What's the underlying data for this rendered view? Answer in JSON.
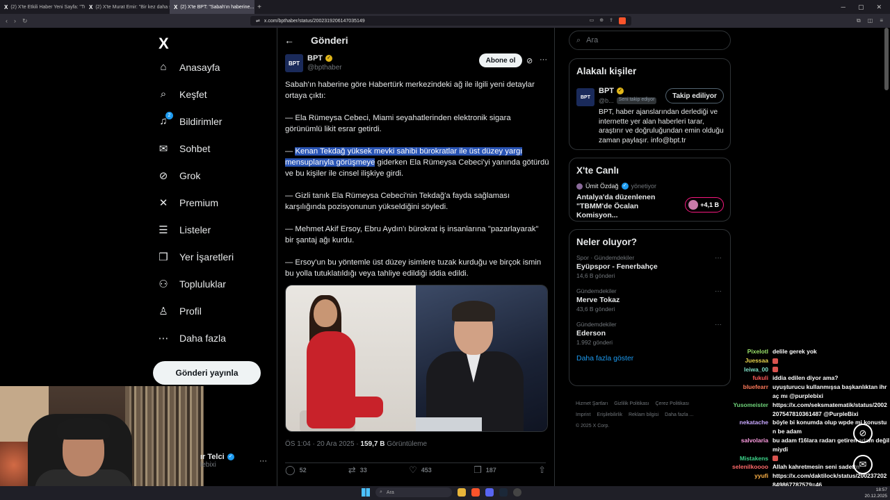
{
  "browser": {
    "tabs": [
      {
        "icon": "X",
        "title": "(2) X'te Etkili Haber Yeni Sayfa: \"Tunc..."
      },
      {
        "icon": "X",
        "title": "(2) X'te Murat Emir: \"Bir kez daha söy..."
      },
      {
        "icon": "X",
        "title": "(2) X'te BPT: \"Sabah'ın haberine..."
      }
    ],
    "url": "x.com/bpthaber/status/2002319206147035149"
  },
  "sidebar": {
    "logo": "X",
    "items": [
      {
        "label": "Anasayfa",
        "icon": "home-icon",
        "glyph": "⌂"
      },
      {
        "label": "Keşfet",
        "icon": "search-icon",
        "glyph": "⌕"
      },
      {
        "label": "Bildirimler",
        "icon": "bell-icon",
        "glyph": "♫",
        "badge": "2"
      },
      {
        "label": "Sohbet",
        "icon": "mail-icon",
        "glyph": "✉"
      },
      {
        "label": "Grok",
        "icon": "grok-icon",
        "glyph": "⊘"
      },
      {
        "label": "Premium",
        "icon": "x-premium-icon",
        "glyph": "✕"
      },
      {
        "label": "Listeler",
        "icon": "list-icon",
        "glyph": "☰"
      },
      {
        "label": "Yer İşaretleri",
        "icon": "bookmark-icon",
        "glyph": "❒"
      },
      {
        "label": "Topluluklar",
        "icon": "communities-icon",
        "glyph": "⚇"
      },
      {
        "label": "Profil",
        "icon": "profile-icon",
        "glyph": "♙"
      },
      {
        "label": "Daha fazla",
        "icon": "more-icon",
        "glyph": "⋯"
      }
    ],
    "post_button": "Gönderi yayınla",
    "account": {
      "name": "ır Telci",
      "handle": "lebixi"
    }
  },
  "post": {
    "header_title": "Gönderi",
    "author": {
      "name": "BPT",
      "handle": "@bpthaber",
      "avatar_text": "BPT"
    },
    "subscribe_label": "Abone ol",
    "paragraphs": [
      {
        "pre": "",
        "hl": "",
        "post": "Sabah'ın haberine göre Habertürk merkezindeki ağ ile ilgili yeni detaylar ortaya çıktı:"
      },
      {
        "pre": "",
        "hl": "",
        "post": "— Ela Rümeysa Cebeci, Miami seyahatlerinden elektronik sigara görünümlü likit esrar getirdi."
      },
      {
        "pre": "— ",
        "hl": "Kenan Tekdağ yüksek mevki sahibi bürokratlar ile üst düzey yargı mensuplarıyla görüşmeye",
        "post": " giderken Ela Rümeysa Cebeci'yi yanında götürdü ve bu kişiler ile cinsel ilişkiye girdi."
      },
      {
        "pre": "",
        "hl": "",
        "post": "— Gizli tanık Ela Rümeysa Cebeci'nin Tekdağ'a fayda sağlaması karşılığında pozisyonunun yükseldiğini söyledi."
      },
      {
        "pre": "",
        "hl": "",
        "post": "— Mehmet Akif Ersoy, Ebru Aydın'ı bürokrat iş insanlarına \"pazarlayarak\" bir şantaj ağı kurdu."
      },
      {
        "pre": "",
        "hl": "",
        "post": "— Ersoy'un bu yöntemle üst düzey isimlere tuzak kurduğu ve birçok ismin bu yolla tutuklatıldığı veya tahliye edildiği iddia edildi."
      }
    ],
    "time": "ÖS 1:04 · 20 Ara 2025 · ",
    "views": "159,7 B",
    "views_label": " Görüntüleme",
    "stats": {
      "replies": "52",
      "reposts": "33",
      "likes": "453",
      "bookmarks": "187"
    }
  },
  "right": {
    "search_placeholder": "Ara",
    "related_title": "Alakalı kişiler",
    "related": {
      "name": "BPT",
      "handle": "@b...",
      "tag": "Seni takip ediyor",
      "follow_label": "Takip ediliyor",
      "bio": "BPT, haber ajanslarından derlediği ve internette yer alan haberleri tarar, araştırır ve doğruluğundan emin olduğu zaman paylaşır. info@bpt.tr",
      "avatar_text": "BPT"
    },
    "live_title": "X'te Canlı",
    "live": {
      "host": "Ümit Özdağ",
      "role": "yönetiyor",
      "title": "Antalya'da düzenlenen \"TBMM'de Öcalan Komisyon...",
      "count": "+4,1 B"
    },
    "trends_title": "Neler oluyor?",
    "trends": [
      {
        "category": "Spor · Gündemdekiler",
        "title": "Eyüpspor - Fenerbahçe",
        "count": "14,6 B gönderi"
      },
      {
        "category": "Gündemdekiler",
        "title": "Merve Tokaz",
        "count": "43,6 B gönderi"
      },
      {
        "category": "Gündemdekiler",
        "title": "Ederson",
        "count": "1.992 gönderi"
      }
    ],
    "show_more": "Daha fazla göster",
    "footer": [
      "Hizmet Şartları",
      "Gizlilik Politikası",
      "Çerez Politikası",
      "Imprint",
      "Erişilebilirlik",
      "Reklam bilgisi",
      "Daha fazla ...",
      "© 2025 X Corp."
    ]
  },
  "chat": [
    {
      "user": "Pixelotl",
      "color": "#9be36b",
      "text": "delile gerek yok"
    },
    {
      "user": "Juessaa",
      "color": "#e8d44d",
      "text": "",
      "emote": true
    },
    {
      "user": "leiwa_00",
      "color": "#7fe0c8",
      "text": "",
      "emote": true
    },
    {
      "user": "fukuli",
      "color": "#ff5a5a",
      "text": "iddia edilen diyor ama?"
    },
    {
      "user": "bluefearr",
      "color": "#ff7a5a",
      "text": "uyuşturucu kullanmışsa başkanlıktan ihraç mı @purplebixi"
    },
    {
      "user": "Yusomeister",
      "color": "#6fd47a",
      "text": "https://x.com/seksmatematik/status/2002207547810361487 @PurpleBixi"
    },
    {
      "user": "nekatache",
      "color": "#c8a8ff",
      "text": "böyle bi konumda olup wpde mi konustun be adam"
    },
    {
      "user": "salvolaria",
      "color": "#ff9de2",
      "text": "bu adam f16lara radarı getiren adam değil miydi"
    },
    {
      "user": "Mistakens",
      "color": "#3cd48a",
      "text": "",
      "emote": true
    },
    {
      "user": "selenilkoooo",
      "color": "#ff6a6a",
      "text": "Allah kahretmesin seni sadettn"
    },
    {
      "user": "yyufi",
      "color": "#ffb347",
      "text": "https://x.com/daktilock/status/200237202849867787579=46"
    }
  ],
  "taskbar": {
    "search": "Ara",
    "time": "18:57",
    "date": "20.12.2025"
  }
}
